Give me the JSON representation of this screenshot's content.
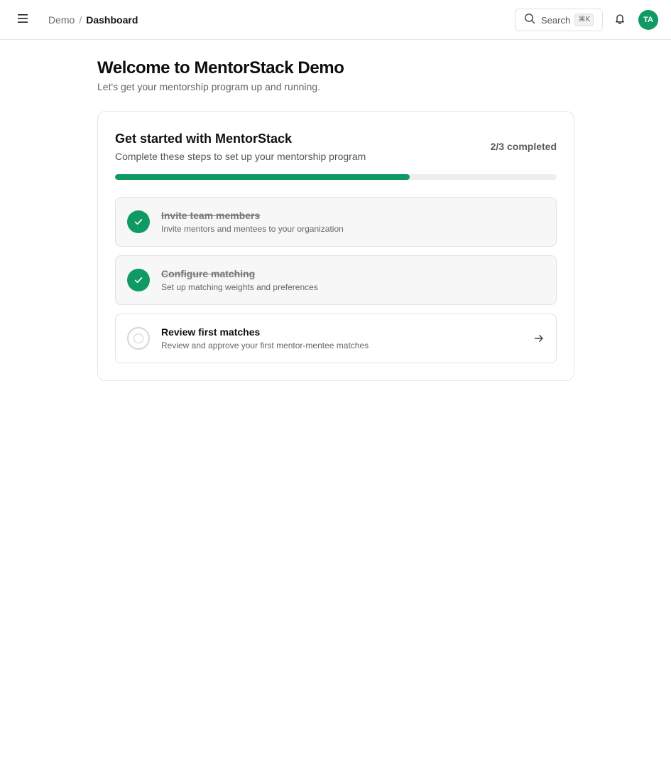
{
  "header": {
    "breadcrumb": {
      "parent": "Demo",
      "separator": "/",
      "current": "Dashboard"
    },
    "search": {
      "label": "Search",
      "shortcut": "⌘K"
    },
    "avatar_initials": "TA",
    "icons": [
      "menu-icon",
      "search-icon",
      "bell-icon"
    ]
  },
  "main": {
    "title": "Welcome to MentorStack Demo",
    "subtitle": "Let's get your mentorship program up and running."
  },
  "onboarding": {
    "title": "Get started with MentorStack",
    "subtitle": "Complete these steps to set up your mentorship program",
    "progress_text": "2/3 completed",
    "completed": 2,
    "total": 3,
    "steps": [
      {
        "title": "Invite team members",
        "description": "Invite mentors and mentees to your organization",
        "status": "completed"
      },
      {
        "title": "Configure matching",
        "description": "Set up matching weights and preferences",
        "status": "completed"
      },
      {
        "title": "Review first matches",
        "description": "Review and approve your first mentor-mentee matches",
        "status": "pending"
      }
    ]
  },
  "colors": {
    "accent": "#0f9a63",
    "track": "#eeeeee",
    "border": "#e5e5e5"
  }
}
